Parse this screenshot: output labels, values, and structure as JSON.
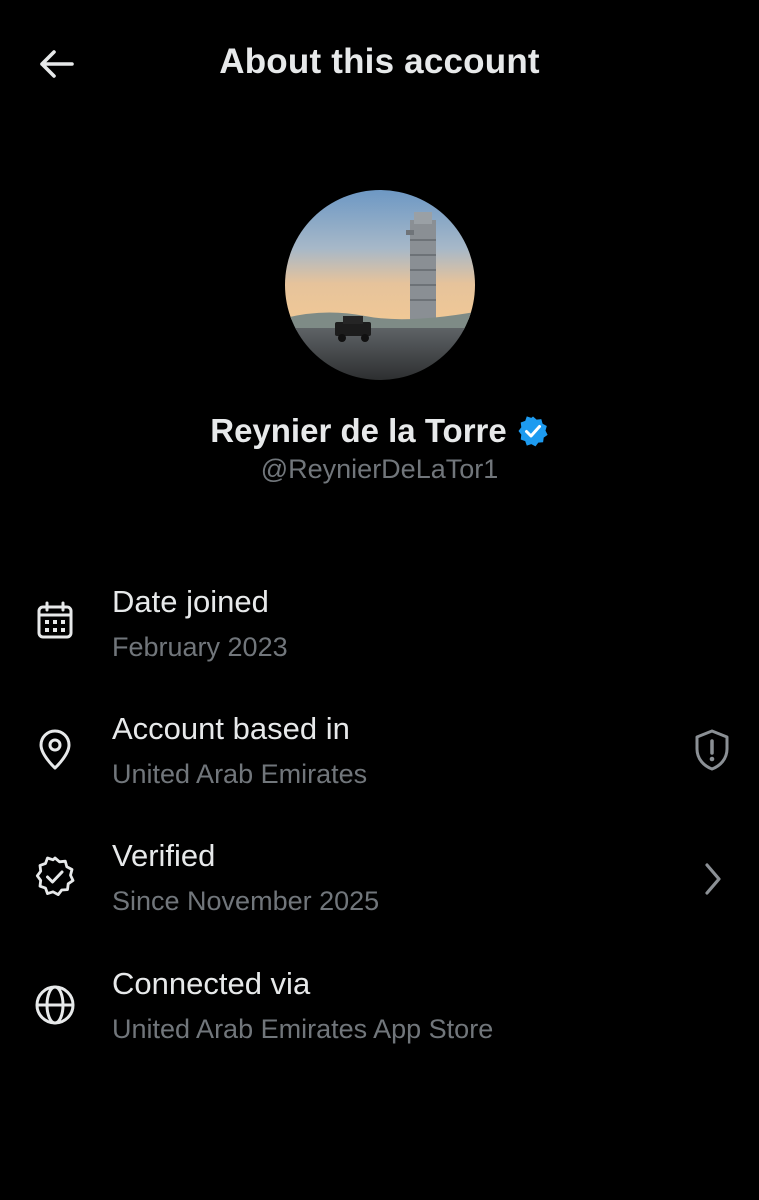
{
  "header": {
    "back_icon": "arrow-left-icon",
    "title": "About this account"
  },
  "profile": {
    "avatar_description_icon": "avatar-image",
    "display_name": "Reynier de la Torre",
    "verified_badge_color": "#1d9bf0",
    "handle": "@ReynierDeLaTor1"
  },
  "info": {
    "date_joined": {
      "icon": "calendar-icon",
      "label": "Date joined",
      "value": "February 2023"
    },
    "account_based_in": {
      "icon": "location-pin-icon",
      "label": "Account based in",
      "value": "United Arab Emirates",
      "trailing_icon": "shield-alert-icon"
    },
    "verified": {
      "icon": "verified-check-icon",
      "label": "Verified",
      "value": "Since November 2025",
      "trailing_icon": "chevron-right-icon"
    },
    "connected_via": {
      "icon": "globe-icon",
      "label": "Connected via",
      "value": "United Arab Emirates App Store"
    }
  },
  "colors": {
    "background": "#000000",
    "primary_text": "#e7e9ea",
    "secondary_text": "#71767b",
    "accent": "#1d9bf0"
  }
}
